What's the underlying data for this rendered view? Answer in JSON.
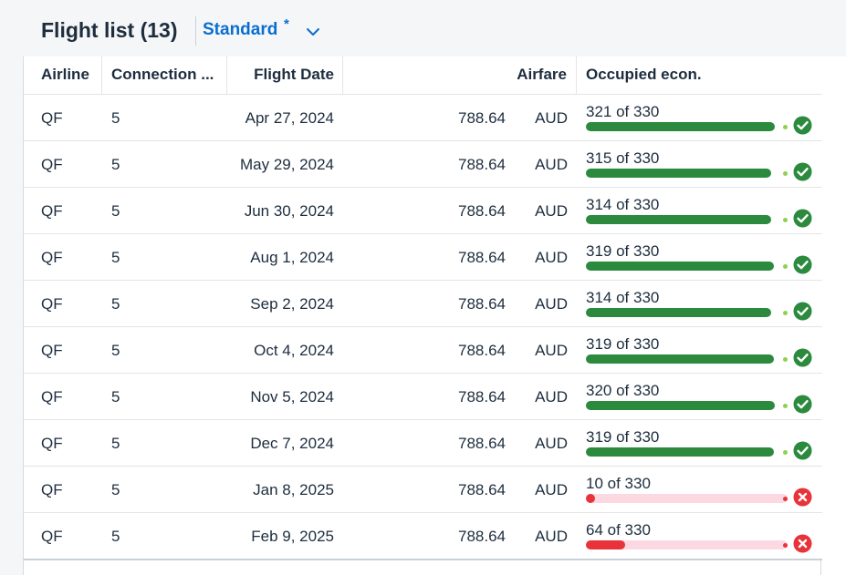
{
  "header": {
    "title": "Flight list (13)",
    "variant": "Standard",
    "variant_modified": "*"
  },
  "table": {
    "columns": [
      "Airline",
      "Connection ...",
      "Flight Date",
      "Airfare",
      "Occupied econ."
    ],
    "rows": [
      {
        "airline": "QF",
        "connection": "5",
        "date": "Apr 27, 2024",
        "fare": "788.64",
        "currency": "AUD",
        "occupancy": "321 of 330",
        "occupied": 321,
        "capacity": 330,
        "status": "success"
      },
      {
        "airline": "QF",
        "connection": "5",
        "date": "May 29, 2024",
        "fare": "788.64",
        "currency": "AUD",
        "occupancy": "315 of 330",
        "occupied": 315,
        "capacity": 330,
        "status": "success"
      },
      {
        "airline": "QF",
        "connection": "5",
        "date": "Jun 30, 2024",
        "fare": "788.64",
        "currency": "AUD",
        "occupancy": "314 of 330",
        "occupied": 314,
        "capacity": 330,
        "status": "success"
      },
      {
        "airline": "QF",
        "connection": "5",
        "date": "Aug 1, 2024",
        "fare": "788.64",
        "currency": "AUD",
        "occupancy": "319 of 330",
        "occupied": 319,
        "capacity": 330,
        "status": "success"
      },
      {
        "airline": "QF",
        "connection": "5",
        "date": "Sep 2, 2024",
        "fare": "788.64",
        "currency": "AUD",
        "occupancy": "314 of 330",
        "occupied": 314,
        "capacity": 330,
        "status": "success"
      },
      {
        "airline": "QF",
        "connection": "5",
        "date": "Oct 4, 2024",
        "fare": "788.64",
        "currency": "AUD",
        "occupancy": "319 of 330",
        "occupied": 319,
        "capacity": 330,
        "status": "success"
      },
      {
        "airline": "QF",
        "connection": "5",
        "date": "Nov 5, 2024",
        "fare": "788.64",
        "currency": "AUD",
        "occupancy": "320 of 330",
        "occupied": 320,
        "capacity": 330,
        "status": "success"
      },
      {
        "airline": "QF",
        "connection": "5",
        "date": "Dec 7, 2024",
        "fare": "788.64",
        "currency": "AUD",
        "occupancy": "319 of 330",
        "occupied": 319,
        "capacity": 330,
        "status": "success"
      },
      {
        "airline": "QF",
        "connection": "5",
        "date": "Jan 8, 2025",
        "fare": "788.64",
        "currency": "AUD",
        "occupancy": "10 of 330",
        "occupied": 10,
        "capacity": 330,
        "status": "error"
      },
      {
        "airline": "QF",
        "connection": "5",
        "date": "Feb 9, 2025",
        "fare": "788.64",
        "currency": "AUD",
        "occupancy": "64 of 330",
        "occupied": 64,
        "capacity": 330,
        "status": "error"
      }
    ]
  },
  "icons": {
    "variant_toggle": "chevron-down-icon",
    "success": "check-circle-icon",
    "error": "error-circle-icon"
  },
  "colors": {
    "accent": "#0a6ed1",
    "success": "#2b8a3e",
    "success_dot": "#8fd14f",
    "error": "#e9333b",
    "error_track": "#fcd9e2"
  }
}
